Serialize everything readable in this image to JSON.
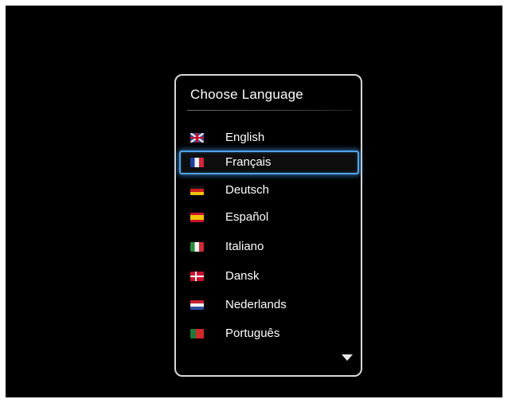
{
  "dialog": {
    "title": "Choose  Language",
    "scroll_icon": "triangle-down",
    "languages": [
      {
        "label": "English",
        "flag": "uk",
        "selected": false
      },
      {
        "label": "Français",
        "flag": "france",
        "selected": true
      },
      {
        "label": "Deutsch",
        "flag": "germany",
        "selected": false
      },
      {
        "label": "Español",
        "flag": "spain",
        "selected": false
      },
      {
        "label": "Italiano",
        "flag": "italy",
        "selected": false
      },
      {
        "label": "Dansk",
        "flag": "denmark",
        "selected": false
      },
      {
        "label": "Nederlands",
        "flag": "netherlands",
        "selected": false
      },
      {
        "label": "Português",
        "flag": "portugal",
        "selected": false
      }
    ]
  },
  "colors": {
    "background": "#000000",
    "border": "#d8d8d8",
    "highlight": "#4fa3e6",
    "text": "#ffffff"
  }
}
